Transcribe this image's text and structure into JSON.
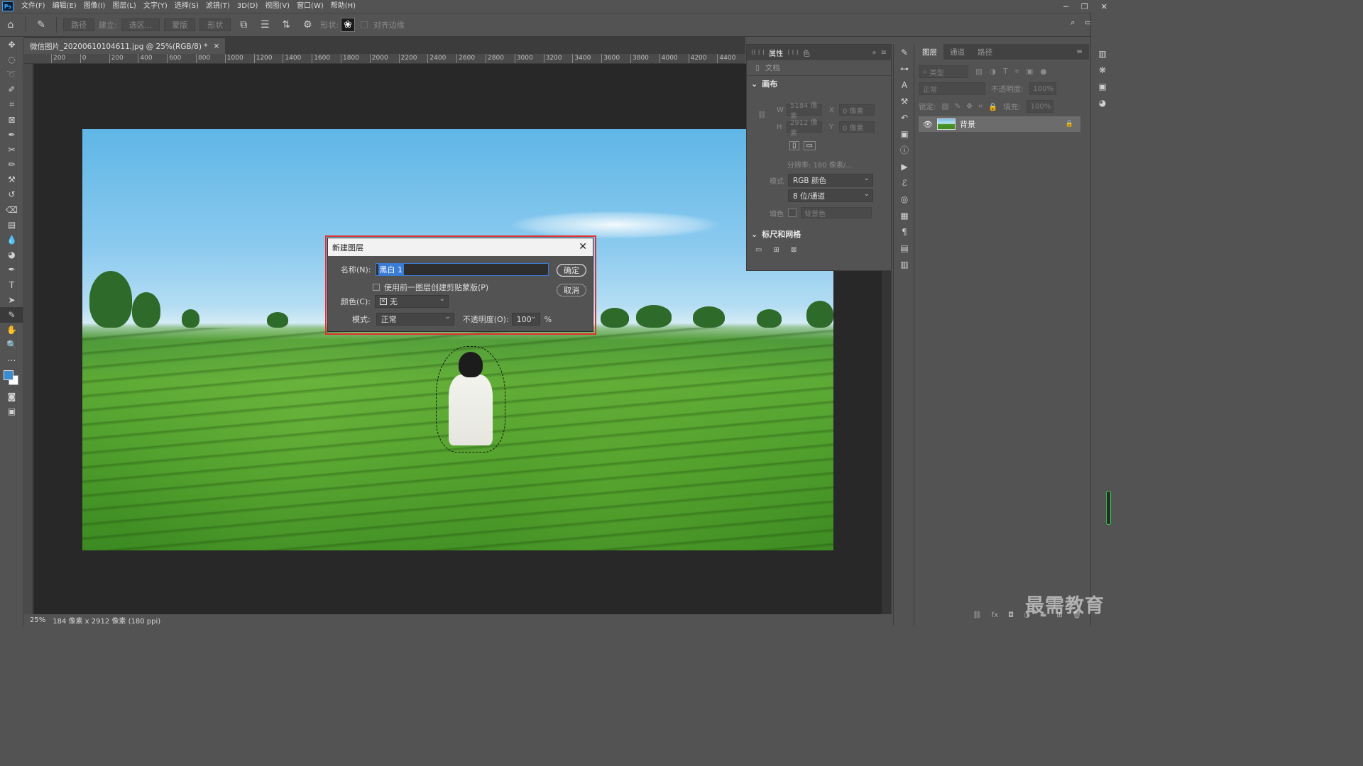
{
  "menubar": {
    "logo": "Ps",
    "items": [
      "文件(F)",
      "编辑(E)",
      "图像(I)",
      "图层(L)",
      "文字(Y)",
      "选择(S)",
      "滤镜(T)",
      "3D(D)",
      "视图(V)",
      "窗口(W)",
      "帮助(H)"
    ]
  },
  "optbar": {
    "path_mode": "路径",
    "make_label": "建立:",
    "selection_btn": "选区...",
    "mask_btn": "蒙版",
    "shape_btn": "形状",
    "shape_label": "形状:",
    "align_edges": "对齐边缘"
  },
  "document": {
    "tab_title": "微信图片_20200610104611.jpg @ 25%(RGB/8) *",
    "ruler_ticks": [
      "200",
      "0",
      "200",
      "400",
      "600",
      "800",
      "1000",
      "1200",
      "1400",
      "1600",
      "1800",
      "2000",
      "2200",
      "2400",
      "2600",
      "2800",
      "3000",
      "3200",
      "3400",
      "3600",
      "3800",
      "4000",
      "4200",
      "4400"
    ],
    "zoom": "25%",
    "status": "184 像素 x 2912 像素 (180 ppi)"
  },
  "dialog": {
    "title": "新建图层",
    "name_label": "名称(N):",
    "name_value": "黑白 1",
    "clip_label": "使用前一图层创建剪贴蒙版(P)",
    "color_label": "颜色(C):",
    "color_value": "无",
    "mode_label": "模式:",
    "mode_value": "正常",
    "opacity_label": "不透明度(O):",
    "opacity_value": "100",
    "opacity_unit": "%",
    "ok": "确定",
    "cancel": "取消"
  },
  "properties": {
    "tab_active": "属性",
    "tab_other": "色",
    "doc_label": "文档",
    "canvas_section": "画布",
    "w_label": "W",
    "w_value": "5184 像素",
    "h_label": "H",
    "h_value": "2912 像素",
    "x_label": "X",
    "x_value": "0 像素",
    "y_label": "Y",
    "y_value": "0 像素",
    "resolution": "分辨率: 180 像素/...",
    "mode_label": "模式",
    "mode_value": "RGB 颜色",
    "depth_value": "8 位/通道",
    "fill_label": "填色",
    "fill_value": "背景色",
    "rulers_section": "标尺和网格"
  },
  "layers": {
    "tabs": [
      "图层",
      "通道",
      "路径"
    ],
    "filter_kind": "类型",
    "blend_mode": "正常",
    "opacity_label": "不透明度:",
    "opacity_value": "100%",
    "lock_label": "锁定:",
    "fill_label": "填充:",
    "fill_value": "100%",
    "layer_name": "背景",
    "bottom_icons": [
      "link",
      "fx",
      "mask",
      "adjust",
      "group",
      "new",
      "delete"
    ]
  },
  "watermark": "最需教育",
  "colors": {
    "accent_blue": "#3a7bd5",
    "highlight_red": "#e03030",
    "fg_color": "#3a8bd0",
    "bg_color": "#ffffff"
  }
}
